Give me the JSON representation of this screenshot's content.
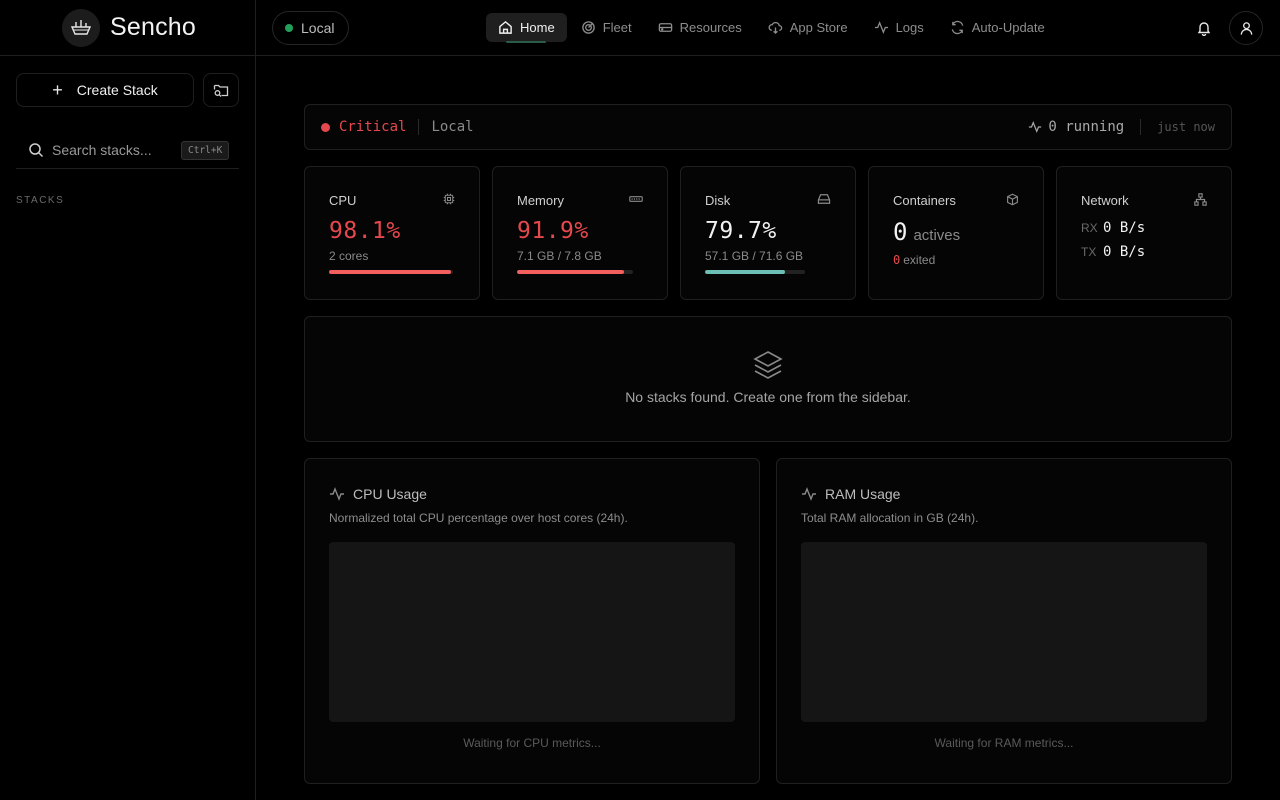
{
  "app": {
    "name": "Sencho"
  },
  "sidebar": {
    "create_label": "Create Stack",
    "search_placeholder": "Search stacks...",
    "search_shortcut": "Ctrl+K",
    "section_label": "STACKS"
  },
  "topbar": {
    "environment": "Local",
    "nav": [
      {
        "label": "Home",
        "icon": "home-icon",
        "active": true
      },
      {
        "label": "Fleet",
        "icon": "radar-icon"
      },
      {
        "label": "Resources",
        "icon": "hard-drive-icon"
      },
      {
        "label": "App Store",
        "icon": "cloud-download-icon"
      },
      {
        "label": "Logs",
        "icon": "activity-icon"
      },
      {
        "label": "Auto-Update",
        "icon": "refresh-icon"
      }
    ]
  },
  "status": {
    "level": "Critical",
    "environment": "Local",
    "running": "0 running",
    "updated": "just now",
    "colors": {
      "critical": "#e5484d",
      "ok": "#21a05a"
    }
  },
  "metrics": {
    "cpu": {
      "label": "CPU",
      "value": "98.1%",
      "sub": "2 cores",
      "percent": 98.1,
      "color": "#f35e5e"
    },
    "memory": {
      "label": "Memory",
      "value": "91.9%",
      "sub": "7.1 GB / 7.8 GB",
      "percent": 91.9,
      "color": "#f35e5e"
    },
    "disk": {
      "label": "Disk",
      "value": "79.7%",
      "sub": "57.1 GB / 71.6 GB",
      "percent": 79.7,
      "color": "#6bbfb5"
    },
    "containers": {
      "label": "Containers",
      "active_count": "0",
      "active_label": "actives",
      "exited_count": "0",
      "exited_label": "exited"
    },
    "network": {
      "label": "Network",
      "rx_label": "RX",
      "rx_value": "0 B/s",
      "tx_label": "TX",
      "tx_value": "0 B/s"
    }
  },
  "empty_state": {
    "message": "No stacks found. Create one from the sidebar."
  },
  "charts": {
    "cpu": {
      "title": "CPU Usage",
      "description": "Normalized total CPU percentage over host cores (24h).",
      "waiting": "Waiting for CPU metrics..."
    },
    "ram": {
      "title": "RAM Usage",
      "description": "Total RAM allocation in GB (24h).",
      "waiting": "Waiting for RAM metrics..."
    }
  }
}
